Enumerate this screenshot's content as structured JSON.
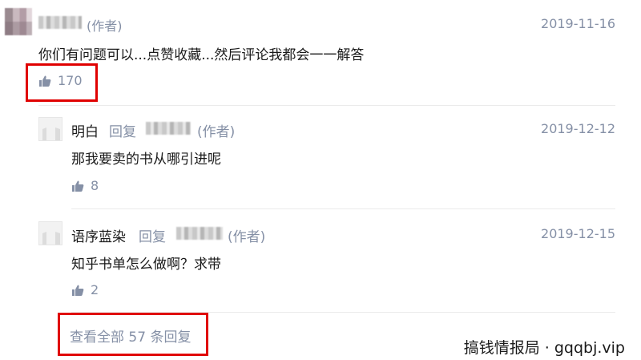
{
  "colors": {
    "meta_gray": "#8590a6",
    "highlight_red": "#e00000",
    "divider": "#ebebeb",
    "text": "#1a1a1a"
  },
  "main_comment": {
    "author_tag": "(作者)",
    "date": "2019-11-16",
    "content": "你们有问题可以...点赞收藏...然后评论我都会一一解答",
    "like_icon": "thumbs-up-icon",
    "likes": "170"
  },
  "replies": [
    {
      "name": "明白",
      "reply_word": "回复",
      "author_tag": "(作者)",
      "date": "2019-12-12",
      "content": "那我要卖的书从哪引进呢",
      "likes": "8"
    },
    {
      "name": "语序蓝染",
      "reply_word": "回复",
      "author_tag": "(作者)",
      "date": "2019-12-15",
      "content": "知乎书单怎么做啊？求带",
      "likes": "2"
    }
  ],
  "view_all": "查看全部 57 条回复",
  "watermark": "搞钱情报局 · gqqbj.vip"
}
